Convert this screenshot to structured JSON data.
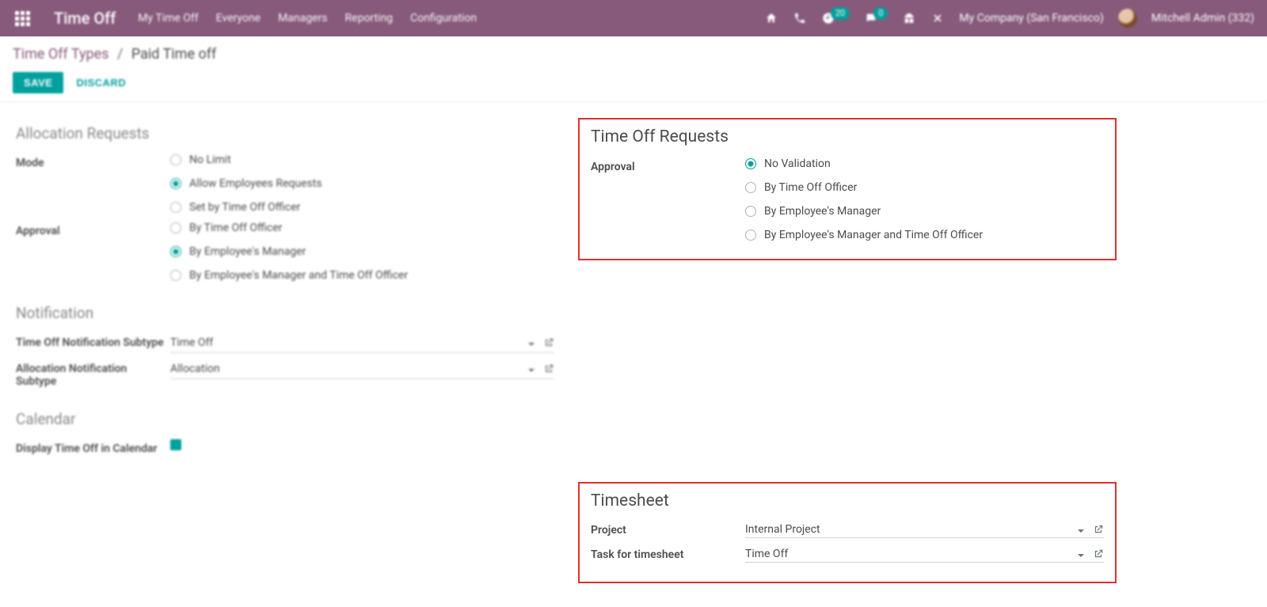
{
  "nav": {
    "brand": "Time Off",
    "menu": [
      "My Time Off",
      "Everyone",
      "Managers",
      "Reporting",
      "Configuration"
    ],
    "badge1": "20",
    "badge2": "0",
    "company": "My Company (San Francisco)",
    "user": "Mitchell Admin (332)"
  },
  "breadcrumb": {
    "parent": "Time Off Types",
    "current": "Paid Time off"
  },
  "actions": {
    "save": "SAVE",
    "discard": "DISCARD"
  },
  "left": {
    "alloc": {
      "title": "Allocation Requests",
      "mode_label": "Mode",
      "mode_opts": [
        "No Limit",
        "Allow Employees Requests",
        "Set by Time Off Officer"
      ],
      "approval_label": "Approval",
      "approval_opts": [
        "By Time Off Officer",
        "By Employee's Manager",
        "By Employee's Manager and Time Off Officer"
      ]
    },
    "notif": {
      "title": "Notification",
      "r1_label": "Time Off Notification Subtype",
      "r1_val": "Time Off",
      "r2_label": "Allocation Notification Subtype",
      "r2_val": "Allocation"
    },
    "cal": {
      "title": "Calendar",
      "r1_label": "Display Time Off in Calendar"
    }
  },
  "right": {
    "req": {
      "title": "Time Off Requests",
      "approval_label": "Approval",
      "opts": [
        "No Validation",
        "By Time Off Officer",
        "By Employee's Manager",
        "By Employee's Manager and Time Off Officer"
      ]
    },
    "ts": {
      "title": "Timesheet",
      "project_label": "Project",
      "project_val": "Internal Project",
      "task_label": "Task for timesheet",
      "task_val": "Time Off"
    }
  }
}
